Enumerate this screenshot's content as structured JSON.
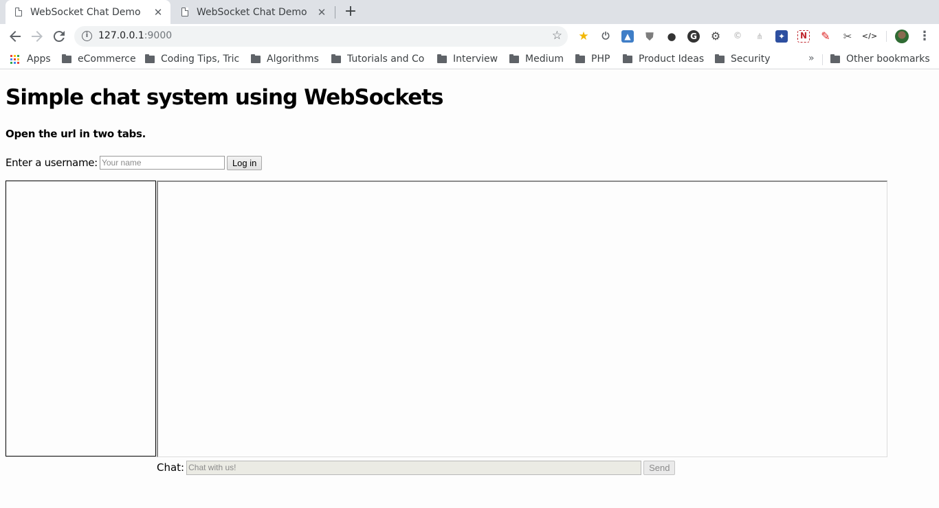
{
  "browser": {
    "tabs": [
      {
        "title": "WebSocket Chat Demo",
        "active": true
      },
      {
        "title": "WebSocket Chat Demo",
        "active": false
      }
    ],
    "new_tab_symbol": "+",
    "close_symbol": "✕",
    "address": {
      "host": "127.0.0.1",
      "port": ":9000"
    },
    "extensions": [
      "star-extension-icon",
      "power-icon",
      "drive-icon",
      "shield-icon",
      "spy-icon",
      "g-icon",
      "gear-icon",
      "c-icon",
      "network-icon",
      "puzzle-icon",
      "n-icon",
      "paint-icon",
      "brush-icon",
      "code-icon"
    ],
    "code_ext_label": "</>",
    "n_ext_label": "N",
    "g_ext_label": "G",
    "bookmarks": [
      {
        "label": "Apps",
        "type": "apps"
      },
      {
        "label": "eCommerce",
        "type": "folder"
      },
      {
        "label": "Coding Tips, Tric",
        "type": "folder"
      },
      {
        "label": "Algorithms",
        "type": "folder"
      },
      {
        "label": "Tutorials and Co",
        "type": "folder"
      },
      {
        "label": "Interview",
        "type": "folder"
      },
      {
        "label": "Medium",
        "type": "folder"
      },
      {
        "label": "PHP",
        "type": "folder"
      },
      {
        "label": "Product Ideas",
        "type": "folder"
      },
      {
        "label": "Security",
        "type": "folder"
      }
    ],
    "bookmarks_more": "»",
    "other_bookmarks": "Other bookmarks"
  },
  "page": {
    "title": "Simple chat system using WebSockets",
    "subtitle": "Open the url in two tabs.",
    "login": {
      "label": "Enter a username:",
      "placeholder": "Your name",
      "value": "",
      "button": "Log in"
    },
    "chat": {
      "label": "Chat:",
      "placeholder": "Chat with us!",
      "value": "",
      "button": "Send"
    }
  }
}
